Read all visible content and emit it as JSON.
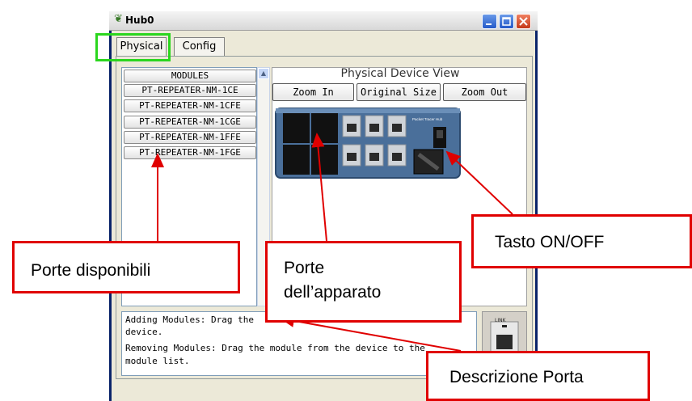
{
  "window": {
    "title": "Hub0"
  },
  "tabs": [
    {
      "label": "Physical"
    },
    {
      "label": "Config"
    }
  ],
  "modules": {
    "header": "MODULES",
    "items": [
      "PT-REPEATER-NM-1CE",
      "PT-REPEATER-NM-1CFE",
      "PT-REPEATER-NM-1CGE",
      "PT-REPEATER-NM-1FFE",
      "PT-REPEATER-NM-1FGE"
    ]
  },
  "device_view": {
    "title": "Physical Device View",
    "zoom_in": "Zoom In",
    "original_size": "Original Size",
    "zoom_out": "Zoom Out",
    "device_brand": "Packet Tracer Hub"
  },
  "description": {
    "lines": [
      "Adding Modules: Drag the",
      "device.",
      "Removing Modules: Drag the module from the device to the",
      "module list."
    ]
  },
  "port_preview": {
    "label": "LINK"
  },
  "annotations": {
    "available_ports": "Porte disponibili",
    "device_ports_line1": "Porte",
    "device_ports_line2": "dell’apparato",
    "power_switch": "Tasto ON/OFF",
    "port_description": "Descrizione Porta"
  },
  "colors": {
    "annotation_red": "#e00000",
    "highlight_green": "#2bd61e",
    "device_blue": "#4a6f9a"
  }
}
